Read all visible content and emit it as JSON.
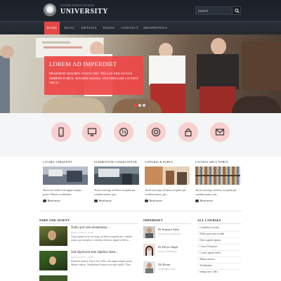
{
  "header": {
    "logo_small": "GOOD EDUCATION",
    "logo_big": "UNIVERSITY",
    "search_placeholder": "Search",
    "colors": {
      "background": "#1b2029",
      "accent": "#e44746"
    }
  },
  "nav": {
    "items": [
      {
        "label": "HOME",
        "active": true
      },
      {
        "label": "BLOG",
        "active": false
      },
      {
        "label": "DETAILS",
        "active": false
      },
      {
        "label": "PAGES",
        "active": false
      },
      {
        "label": "CONTACT",
        "active": false
      },
      {
        "label": "DROPDOWN",
        "active": false,
        "has_dropdown": true
      }
    ]
  },
  "hero": {
    "title": "LOREM AD IMPERDIET",
    "text": "PRAESENT MAURIS. FUSCE NEC TELLUS SED AUGUE SEMPER PORTA. MAURIS MASSA. VESTIBULUM LACINIA ARCU.",
    "slide_count": 3,
    "active_slide": 1
  },
  "features": [
    {
      "icon": "mobile-icon"
    },
    {
      "icon": "monitor-icon"
    },
    {
      "icon": "globe-icon"
    },
    {
      "icon": "lifebuoy-icon"
    },
    {
      "icon": "lock-icon"
    },
    {
      "icon": "envelope-icon"
    }
  ],
  "cards": [
    {
      "title": "LIVORA TORQUENT",
      "text": "Fusce nec tellus sed augue semper porta. Mauris vestibulum...",
      "more": "Read more"
    },
    {
      "title": "ELEMENTUM CONSECTETUR",
      "text": "Taciti sociosqu ad litora torquent per conubia nostra, per...",
      "more": "Read more"
    },
    {
      "title": "CONUBIA & PORTA",
      "text": "Taciti sociosqu ad litora torquent per conubia nostra, per...",
      "more": "Read more"
    },
    {
      "title": "LACINIA ARCU PORTA",
      "text": "Taciti sociosqu ad litora torquent per conubia nostra, per...",
      "more": "Read more"
    }
  ],
  "news": {
    "heading": "NIBH AND AFIENT",
    "items": [
      {
        "title": "Nulla quis sem elementum...",
        "date": "April 12, 2013 - 14:23",
        "text": "Class aptent taciti sociosqu ad litora torquent per conubia nostra, per inceptos. Curabitur lobortis ligula in libero..."
      },
      {
        "title": "Sed dignissim ante dapibus diam...",
        "date": "April 12, 2013 - 14:23",
        "text": "Praesent mauris. Fusce nec tellus sed augue semper porta. Mauris massa. Vestibulum lacinia arcu eget nulla. Class..."
      }
    ]
  },
  "people": {
    "heading": "IMPERDIET",
    "items": [
      {
        "name": "Dr Kumara Adva",
        "role": "Ullamcorper elementum"
      },
      {
        "name": "Dr Divya Singh",
        "role": "Inceptos elementum"
      },
      {
        "name": "Nil Room",
        "role": "Vestibulum lacinia"
      }
    ]
  },
  "courses": {
    "heading": "ALL COURSES",
    "items": [
      "Curabitur Lacinia",
      "Nulla quis sem at nibh",
      "Duis sagittis ipsum",
      "Litora Torquent",
      "Lorem ipsum dolor",
      "Mauris massa",
      "Vestibulum",
      "Integer nec odio"
    ]
  }
}
